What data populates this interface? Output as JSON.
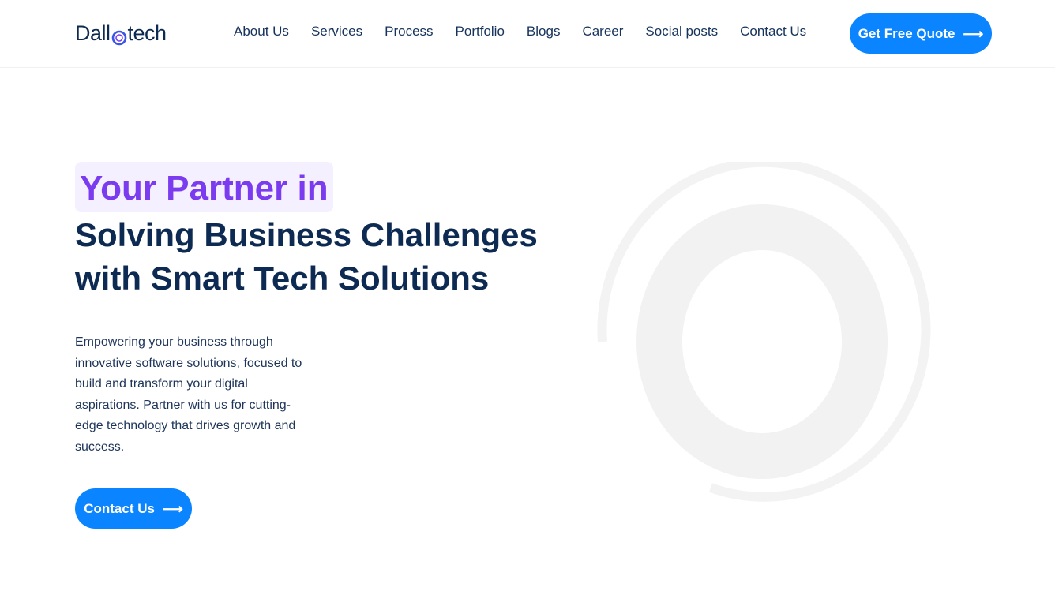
{
  "header": {
    "logo_prefix": "Dall",
    "logo_suffix": "tech",
    "nav": [
      {
        "label": "About Us"
      },
      {
        "label": "Services"
      },
      {
        "label": "Process"
      },
      {
        "label": "Portfolio"
      },
      {
        "label": "Blogs"
      },
      {
        "label": "Career"
      },
      {
        "label": "Social posts"
      },
      {
        "label": "Contact Us"
      }
    ],
    "quote_button": "Get Free Quote",
    "arrow_icon": "arrow-right-icon"
  },
  "hero": {
    "highlight": "Your Partner in",
    "title_line1": "Solving Business Challenges",
    "title_line2": "with Smart Tech Solutions",
    "description": "Empowering your business through innovative software solutions, focused to build and transform your digital aspirations. Partner with us for cutting-edge technology that drives growth and success.",
    "cta_label": "Contact Us",
    "decoration_icon": "concentric-rings-graphic"
  },
  "colors": {
    "primary": "#0a84ff",
    "navy": "#0d2b52",
    "accent_purple": "#7b3cf0",
    "highlight_bg": "#f4f0ff",
    "ring_gray": "#f2f2f2"
  }
}
